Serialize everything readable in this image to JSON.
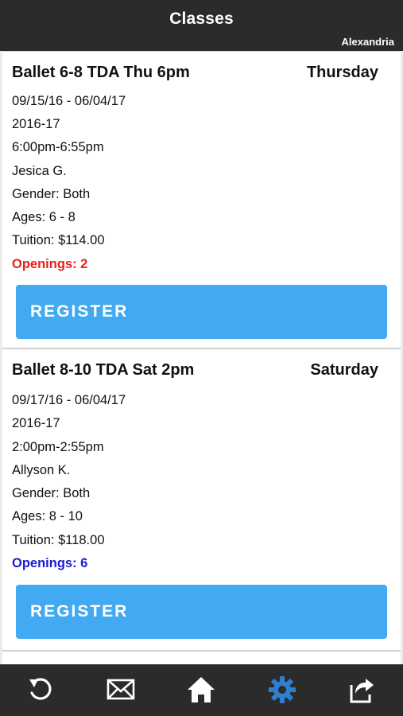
{
  "header": {
    "title": "Classes",
    "location": "Alexandria"
  },
  "classes": [
    {
      "name": "Ballet 6-8 TDA Thu 6pm",
      "day": "Thursday",
      "dates": "09/15/16 - 06/04/17",
      "season": "2016-17",
      "time": "6:00pm-6:55pm",
      "instructor": "Jesica G.",
      "gender": "Gender: Both",
      "ages": "Ages: 6 - 8",
      "tuition": "Tuition: $114.00",
      "openings": "Openings: 2",
      "openings_color": "#e8201c",
      "register_label": "REGISTER"
    },
    {
      "name": "Ballet 8-10 TDA Sat 2pm",
      "day": "Saturday",
      "dates": "09/17/16 - 06/04/17",
      "season": "2016-17",
      "time": "2:00pm-2:55pm",
      "instructor": "Allyson K.",
      "gender": "Gender: Both",
      "ages": "Ages: 8 - 10",
      "tuition": "Tuition: $118.00",
      "openings": "Openings: 6",
      "openings_color": "#1a1ad6",
      "register_label": "REGISTER"
    }
  ],
  "bottom_bar": {
    "icons": [
      "undo-icon",
      "mail-icon",
      "home-icon",
      "gear-icon",
      "share-icon"
    ],
    "active": "gear-icon",
    "active_color": "#2f7fd0",
    "inactive_color": "#ffffff"
  }
}
